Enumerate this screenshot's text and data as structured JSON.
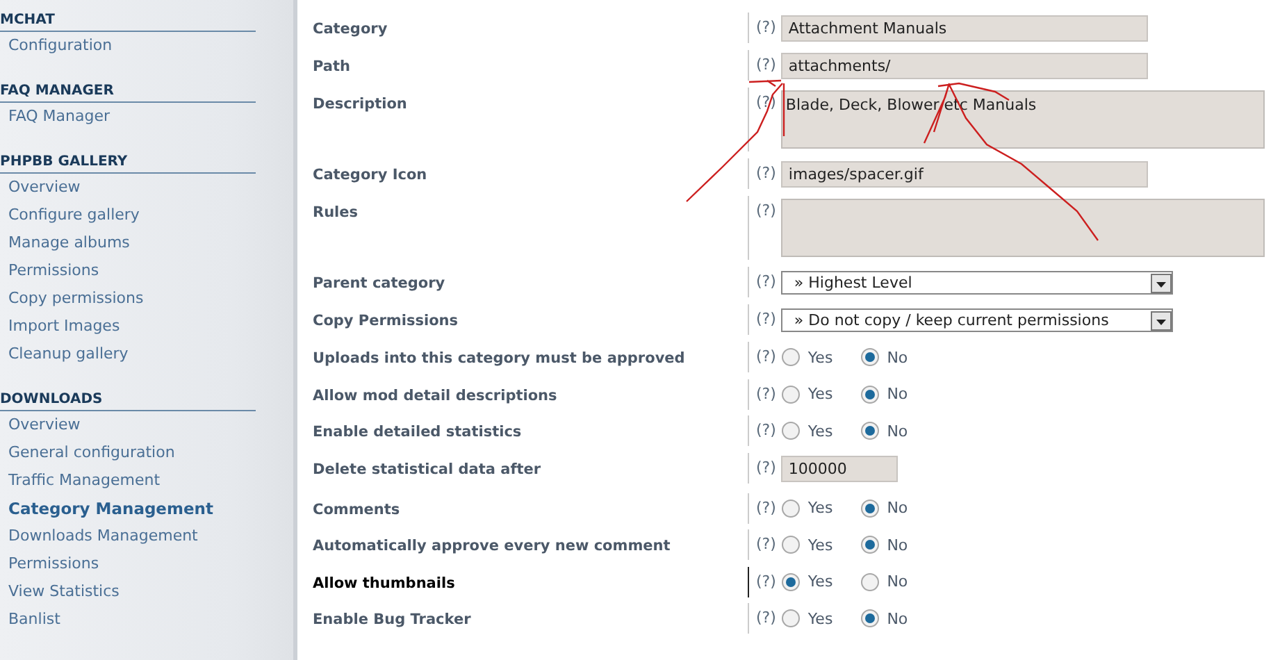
{
  "sidebar": {
    "groups": [
      {
        "title": "MCHAT",
        "items": [
          {
            "label": "Configuration",
            "selected": false
          }
        ]
      },
      {
        "title": "FAQ MANAGER",
        "items": [
          {
            "label": "FAQ Manager",
            "selected": false
          }
        ]
      },
      {
        "title": "PHPBB GALLERY",
        "items": [
          {
            "label": "Overview",
            "selected": false
          },
          {
            "label": "Configure gallery",
            "selected": false
          },
          {
            "label": "Manage albums",
            "selected": false
          },
          {
            "label": "Permissions",
            "selected": false
          },
          {
            "label": "Copy permissions",
            "selected": false
          },
          {
            "label": "Import Images",
            "selected": false
          },
          {
            "label": "Cleanup gallery",
            "selected": false
          }
        ]
      },
      {
        "title": "DOWNLOADS",
        "items": [
          {
            "label": "Overview",
            "selected": false
          },
          {
            "label": "General configuration",
            "selected": false
          },
          {
            "label": "Traffic Management",
            "selected": false
          },
          {
            "label": "Category Management",
            "selected": true
          },
          {
            "label": "Downloads Management",
            "selected": false
          },
          {
            "label": "Permissions",
            "selected": false
          },
          {
            "label": "View Statistics",
            "selected": false
          },
          {
            "label": "Banlist",
            "selected": false
          }
        ]
      }
    ]
  },
  "form": {
    "help": "(?)",
    "rows": [
      {
        "label": "Category",
        "kind": "text",
        "value": "Attachment Manuals",
        "highlighted": false
      },
      {
        "label": "Path",
        "kind": "text",
        "value": "attachments/",
        "highlighted": false
      },
      {
        "label": "Description",
        "kind": "textarea",
        "value": "Blade, Deck, Blower etc Manuals",
        "highlighted": false
      },
      {
        "label": "Category Icon",
        "kind": "text",
        "value": "images/spacer.gif",
        "highlighted": false
      },
      {
        "label": "Rules",
        "kind": "textarea",
        "highlighted": false
      },
      {
        "label": "Parent category",
        "kind": "select",
        "value": "» Highest Level",
        "highlighted": false
      },
      {
        "label": "Copy Permissions",
        "kind": "select",
        "value": "» Do not copy / keep current permissions",
        "highlighted": false
      },
      {
        "label": "Uploads into this category must be approved",
        "kind": "radio",
        "options": [
          {
            "label": "Yes",
            "selected": false
          },
          {
            "label": "No",
            "selected": true
          }
        ],
        "highlighted": false
      },
      {
        "label": "Allow mod detail descriptions",
        "kind": "radio",
        "options": [
          {
            "label": "Yes",
            "selected": false
          },
          {
            "label": "No",
            "selected": true
          }
        ],
        "highlighted": false
      },
      {
        "label": "Enable detailed statistics",
        "kind": "radio",
        "options": [
          {
            "label": "Yes",
            "selected": false
          },
          {
            "label": "No",
            "selected": true
          }
        ],
        "highlighted": false
      },
      {
        "label": "Delete statistical data after",
        "kind": "number",
        "value": "100000",
        "highlighted": false
      },
      {
        "label": "Comments",
        "kind": "radio",
        "options": [
          {
            "label": "Yes",
            "selected": false
          },
          {
            "label": "No",
            "selected": true
          }
        ],
        "highlighted": false
      },
      {
        "label": "Automatically approve every new comment",
        "kind": "radio",
        "options": [
          {
            "label": "Yes",
            "selected": false
          },
          {
            "label": "No",
            "selected": true
          }
        ],
        "highlighted": false
      },
      {
        "label": "Allow thumbnails",
        "kind": "radio",
        "options": [
          {
            "label": "Yes",
            "selected": true
          },
          {
            "label": "No",
            "selected": false
          }
        ],
        "highlighted": true
      },
      {
        "label": "Enable Bug Tracker",
        "kind": "radio",
        "options": [
          {
            "label": "Yes",
            "selected": false
          },
          {
            "label": "No",
            "selected": true
          }
        ],
        "highlighted": false
      }
    ]
  }
}
